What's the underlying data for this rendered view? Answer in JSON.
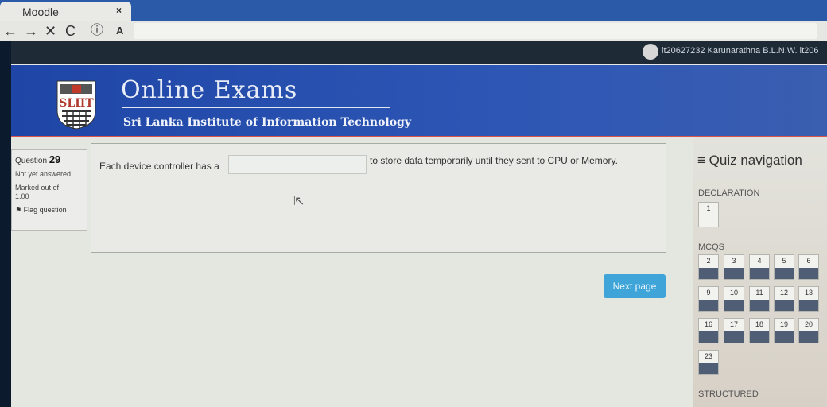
{
  "browser": {
    "tab_title": "Moodle",
    "tab_close": "×",
    "nav_icons": [
      "←",
      "→",
      "✕",
      "C",
      "ⓘ",
      "A"
    ]
  },
  "user": {
    "name": "it20627232 Karunarathna B.L.N.W. it206"
  },
  "banner": {
    "logo_text": "SLIIT",
    "title": "Online Exams",
    "subtitle": "Sri Lanka Institute of Information Technology"
  },
  "question": {
    "label": "Question",
    "number": "29",
    "state": "Not yet answered",
    "marked_out_of": "Marked out of",
    "marks": "1.00",
    "flag": "Flag question",
    "text_before": "Each device controller has a",
    "answer_value": "",
    "text_after": "to store data temporarily until they sent to CPU or Memory."
  },
  "next_button": "Next page",
  "quiz_nav": {
    "title": "≡ Quiz navigation",
    "sections": [
      {
        "label": "DECLARATION",
        "cells": [
          "1"
        ]
      },
      {
        "label": "MCQS",
        "cells": [
          "2",
          "3",
          "4",
          "5",
          "6",
          "9",
          "10",
          "11",
          "12",
          "13",
          "16",
          "17",
          "18",
          "19",
          "20",
          "23"
        ]
      },
      {
        "label": "STRUCTURED",
        "cells": []
      }
    ]
  },
  "colors": {
    "banner_blue": "#2d56b5",
    "button_blue": "#3fa5d8",
    "answered_marker": "#4f5d75"
  }
}
